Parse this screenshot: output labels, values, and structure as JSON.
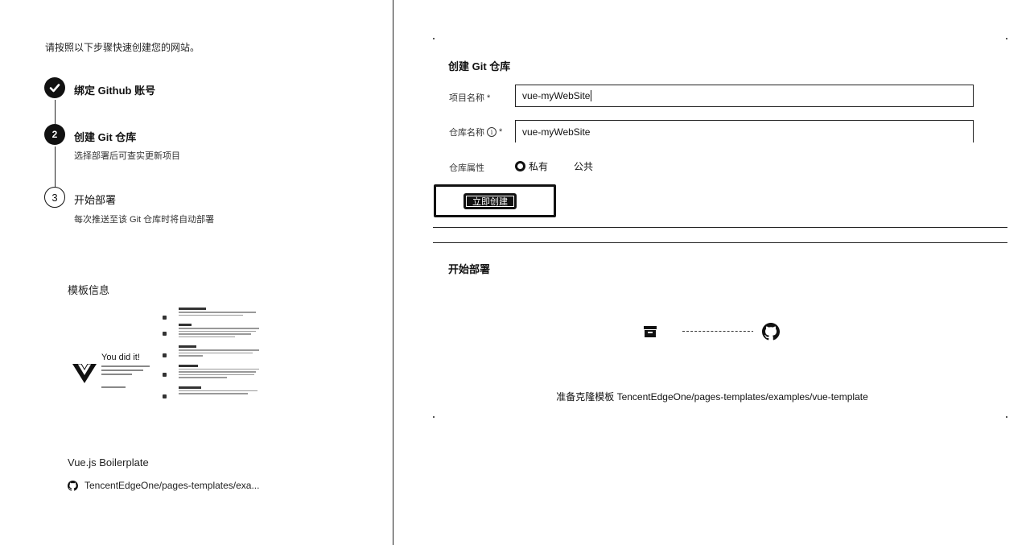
{
  "intro": "请按照以下步骤快速创建您的网站。",
  "steps": [
    {
      "number": "",
      "title": "绑定 Github 账号",
      "description": "",
      "status": "done",
      "icon": "check-circle-icon"
    },
    {
      "number": "2",
      "title": "创建 Git 仓库",
      "description": "选择部署后可查实更新项目",
      "status": "active"
    },
    {
      "number": "3",
      "title": "开始部署",
      "description": "每次推送至该 Git 仓库时将自动部署",
      "status": "pending"
    }
  ],
  "template": {
    "heading": "模板信息",
    "preview_title": "You did it!",
    "name": "Vue.js Boilerplate",
    "repo": "TencentEdgeOne/pages-templates/exa..."
  },
  "create_repo": {
    "title": "创建 Git 仓库",
    "project_label": "项目名称 *",
    "project_value": "vue-myWebSite",
    "repo_label": "仓库名称",
    "repo_required": "*",
    "repo_value": "vue-myWebSite",
    "visibility_label": "仓库属性",
    "visibility_options": [
      "私有",
      "公共"
    ],
    "visibility_selected": "私有",
    "deploy_button": "立即创建"
  },
  "deploy": {
    "title": "开始部署",
    "caption": "准备克隆模板 TencentEdgeOne/pages-templates/examples/vue-template"
  }
}
